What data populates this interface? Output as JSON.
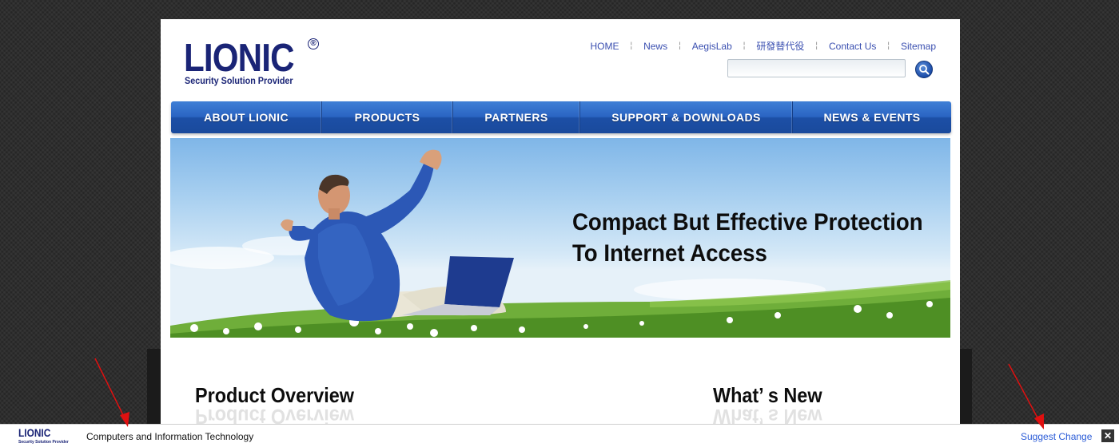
{
  "logo": {
    "wordmark": "LIONIC",
    "registered": "®",
    "tagline": "Security Solution Provider"
  },
  "top_links": [
    "HOME",
    "News",
    "AegisLab",
    "研發替代役",
    "Contact Us",
    "Sitemap"
  ],
  "top_link_separator": "¦",
  "search": {
    "value": "",
    "placeholder": "",
    "button_icon": "search-icon"
  },
  "nav": [
    "ABOUT LIONIC",
    "PRODUCTS",
    "PARTNERS",
    "SUPPORT & DOWNLOADS",
    "NEWS & EVENTS"
  ],
  "banner": {
    "line1": "Compact But Effective Protection",
    "line2": "To Internet Access"
  },
  "sections": {
    "product_overview": "Product Overview",
    "whats_new": "What’ s New"
  },
  "bottom_bar": {
    "logo_word": "LIONIC",
    "logo_tagline": "Security Solution Provider",
    "category": "Computers and Information Technology",
    "suggest_change": "Suggest Change",
    "close_symbol": "✕"
  },
  "colors": {
    "brand_navy": "#1a2476",
    "link_blue": "#3a4fb0",
    "nav_blue": "#2a64c2",
    "annotation_red": "#e01010",
    "suggest_blue": "#2a5bd7"
  }
}
